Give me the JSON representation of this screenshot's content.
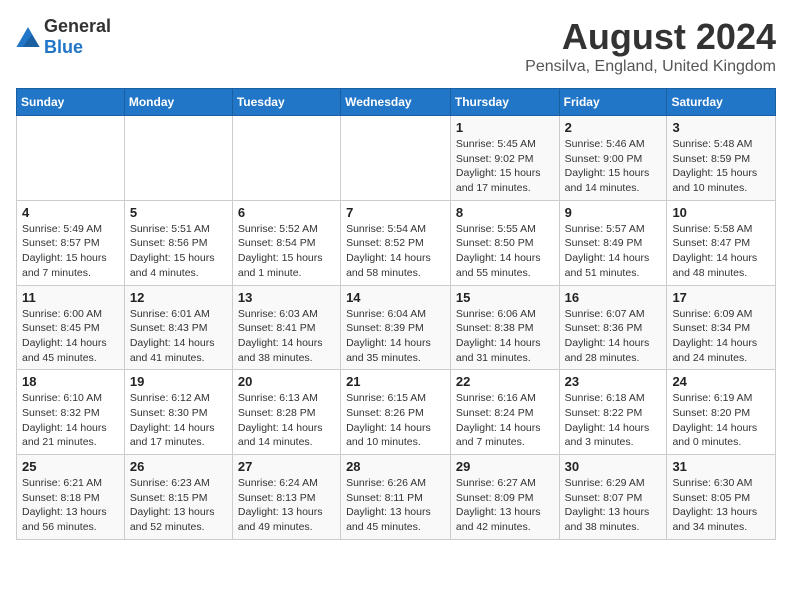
{
  "header": {
    "logo_general": "General",
    "logo_blue": "Blue",
    "month": "August 2024",
    "location": "Pensilva, England, United Kingdom"
  },
  "days_of_week": [
    "Sunday",
    "Monday",
    "Tuesday",
    "Wednesday",
    "Thursday",
    "Friday",
    "Saturday"
  ],
  "weeks": [
    [
      {
        "day": "",
        "info": ""
      },
      {
        "day": "",
        "info": ""
      },
      {
        "day": "",
        "info": ""
      },
      {
        "day": "",
        "info": ""
      },
      {
        "day": "1",
        "sunrise": "Sunrise: 5:45 AM",
        "sunset": "Sunset: 9:02 PM",
        "daylight": "Daylight: 15 hours and 17 minutes."
      },
      {
        "day": "2",
        "sunrise": "Sunrise: 5:46 AM",
        "sunset": "Sunset: 9:00 PM",
        "daylight": "Daylight: 15 hours and 14 minutes."
      },
      {
        "day": "3",
        "sunrise": "Sunrise: 5:48 AM",
        "sunset": "Sunset: 8:59 PM",
        "daylight": "Daylight: 15 hours and 10 minutes."
      }
    ],
    [
      {
        "day": "4",
        "sunrise": "Sunrise: 5:49 AM",
        "sunset": "Sunset: 8:57 PM",
        "daylight": "Daylight: 15 hours and 7 minutes."
      },
      {
        "day": "5",
        "sunrise": "Sunrise: 5:51 AM",
        "sunset": "Sunset: 8:56 PM",
        "daylight": "Daylight: 15 hours and 4 minutes."
      },
      {
        "day": "6",
        "sunrise": "Sunrise: 5:52 AM",
        "sunset": "Sunset: 8:54 PM",
        "daylight": "Daylight: 15 hours and 1 minute."
      },
      {
        "day": "7",
        "sunrise": "Sunrise: 5:54 AM",
        "sunset": "Sunset: 8:52 PM",
        "daylight": "Daylight: 14 hours and 58 minutes."
      },
      {
        "day": "8",
        "sunrise": "Sunrise: 5:55 AM",
        "sunset": "Sunset: 8:50 PM",
        "daylight": "Daylight: 14 hours and 55 minutes."
      },
      {
        "day": "9",
        "sunrise": "Sunrise: 5:57 AM",
        "sunset": "Sunset: 8:49 PM",
        "daylight": "Daylight: 14 hours and 51 minutes."
      },
      {
        "day": "10",
        "sunrise": "Sunrise: 5:58 AM",
        "sunset": "Sunset: 8:47 PM",
        "daylight": "Daylight: 14 hours and 48 minutes."
      }
    ],
    [
      {
        "day": "11",
        "sunrise": "Sunrise: 6:00 AM",
        "sunset": "Sunset: 8:45 PM",
        "daylight": "Daylight: 14 hours and 45 minutes."
      },
      {
        "day": "12",
        "sunrise": "Sunrise: 6:01 AM",
        "sunset": "Sunset: 8:43 PM",
        "daylight": "Daylight: 14 hours and 41 minutes."
      },
      {
        "day": "13",
        "sunrise": "Sunrise: 6:03 AM",
        "sunset": "Sunset: 8:41 PM",
        "daylight": "Daylight: 14 hours and 38 minutes."
      },
      {
        "day": "14",
        "sunrise": "Sunrise: 6:04 AM",
        "sunset": "Sunset: 8:39 PM",
        "daylight": "Daylight: 14 hours and 35 minutes."
      },
      {
        "day": "15",
        "sunrise": "Sunrise: 6:06 AM",
        "sunset": "Sunset: 8:38 PM",
        "daylight": "Daylight: 14 hours and 31 minutes."
      },
      {
        "day": "16",
        "sunrise": "Sunrise: 6:07 AM",
        "sunset": "Sunset: 8:36 PM",
        "daylight": "Daylight: 14 hours and 28 minutes."
      },
      {
        "day": "17",
        "sunrise": "Sunrise: 6:09 AM",
        "sunset": "Sunset: 8:34 PM",
        "daylight": "Daylight: 14 hours and 24 minutes."
      }
    ],
    [
      {
        "day": "18",
        "sunrise": "Sunrise: 6:10 AM",
        "sunset": "Sunset: 8:32 PM",
        "daylight": "Daylight: 14 hours and 21 minutes."
      },
      {
        "day": "19",
        "sunrise": "Sunrise: 6:12 AM",
        "sunset": "Sunset: 8:30 PM",
        "daylight": "Daylight: 14 hours and 17 minutes."
      },
      {
        "day": "20",
        "sunrise": "Sunrise: 6:13 AM",
        "sunset": "Sunset: 8:28 PM",
        "daylight": "Daylight: 14 hours and 14 minutes."
      },
      {
        "day": "21",
        "sunrise": "Sunrise: 6:15 AM",
        "sunset": "Sunset: 8:26 PM",
        "daylight": "Daylight: 14 hours and 10 minutes."
      },
      {
        "day": "22",
        "sunrise": "Sunrise: 6:16 AM",
        "sunset": "Sunset: 8:24 PM",
        "daylight": "Daylight: 14 hours and 7 minutes."
      },
      {
        "day": "23",
        "sunrise": "Sunrise: 6:18 AM",
        "sunset": "Sunset: 8:22 PM",
        "daylight": "Daylight: 14 hours and 3 minutes."
      },
      {
        "day": "24",
        "sunrise": "Sunrise: 6:19 AM",
        "sunset": "Sunset: 8:20 PM",
        "daylight": "Daylight: 14 hours and 0 minutes."
      }
    ],
    [
      {
        "day": "25",
        "sunrise": "Sunrise: 6:21 AM",
        "sunset": "Sunset: 8:18 PM",
        "daylight": "Daylight: 13 hours and 56 minutes."
      },
      {
        "day": "26",
        "sunrise": "Sunrise: 6:23 AM",
        "sunset": "Sunset: 8:15 PM",
        "daylight": "Daylight: 13 hours and 52 minutes."
      },
      {
        "day": "27",
        "sunrise": "Sunrise: 6:24 AM",
        "sunset": "Sunset: 8:13 PM",
        "daylight": "Daylight: 13 hours and 49 minutes."
      },
      {
        "day": "28",
        "sunrise": "Sunrise: 6:26 AM",
        "sunset": "Sunset: 8:11 PM",
        "daylight": "Daylight: 13 hours and 45 minutes."
      },
      {
        "day": "29",
        "sunrise": "Sunrise: 6:27 AM",
        "sunset": "Sunset: 8:09 PM",
        "daylight": "Daylight: 13 hours and 42 minutes."
      },
      {
        "day": "30",
        "sunrise": "Sunrise: 6:29 AM",
        "sunset": "Sunset: 8:07 PM",
        "daylight": "Daylight: 13 hours and 38 minutes."
      },
      {
        "day": "31",
        "sunrise": "Sunrise: 6:30 AM",
        "sunset": "Sunset: 8:05 PM",
        "daylight": "Daylight: 13 hours and 34 minutes."
      }
    ]
  ]
}
